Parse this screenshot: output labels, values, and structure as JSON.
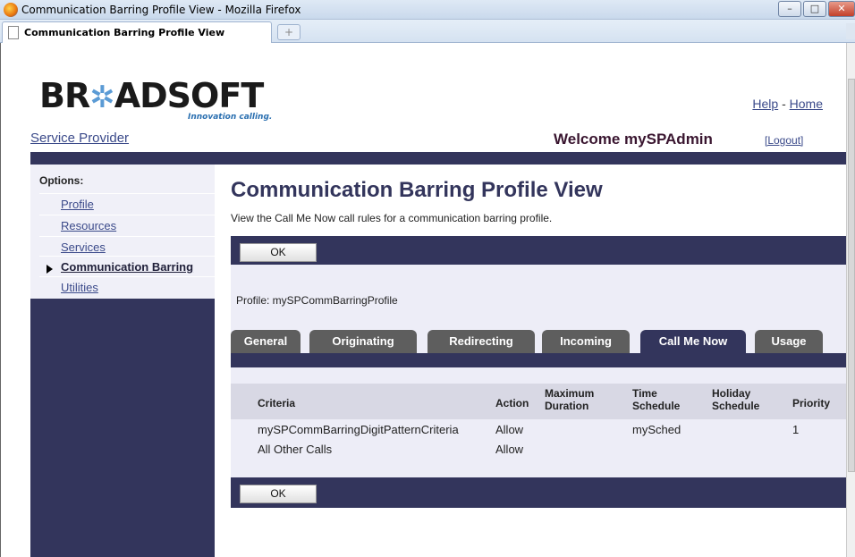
{
  "window": {
    "title": "Communication Barring Profile View - Mozilla Firefox",
    "tab_label": "Communication Barring Profile View",
    "new_tab_symbol": "+",
    "controls": {
      "minimize": "–",
      "maximize": "□",
      "close": "✕"
    }
  },
  "header": {
    "logo_text_1": "BR",
    "logo_star": "✲",
    "logo_text_2": "ADSOFT",
    "tagline": "Innovation calling.",
    "help_link": "Help",
    "separator": "-",
    "home_link": "Home",
    "service_provider_link": "Service Provider",
    "welcome": "Welcome mySPAdmin",
    "logout": "[Logout]"
  },
  "sidebar": {
    "title": "Options:",
    "items": [
      {
        "label": "Profile",
        "active": false
      },
      {
        "label": "Resources",
        "active": false
      },
      {
        "label": "Services",
        "active": false
      },
      {
        "label": "Communication Barring",
        "active": true
      },
      {
        "label": "Utilities",
        "active": false
      }
    ]
  },
  "main": {
    "title": "Communication Barring Profile View",
    "description": "View the Call Me Now call rules for a communication barring profile.",
    "ok_label": "OK",
    "profile_line": "Profile: mySPCommBarringProfile",
    "tabs": [
      {
        "label": "General",
        "active": false
      },
      {
        "label": "Originating",
        "active": false
      },
      {
        "label": "Redirecting",
        "active": false
      },
      {
        "label": "Incoming",
        "active": false
      },
      {
        "label": "Call Me Now",
        "active": true
      },
      {
        "label": "Usage",
        "active": false
      }
    ],
    "table": {
      "headers": {
        "criteria": "Criteria",
        "action": "Action",
        "max_duration_1": "Maximum",
        "max_duration_2": "Duration",
        "time_schedule_1": "Time",
        "time_schedule_2": "Schedule",
        "holiday_schedule_1": "Holiday",
        "holiday_schedule_2": "Schedule",
        "priority": "Priority"
      },
      "rows": [
        {
          "criteria": "mySPCommBarringDigitPatternCriteria",
          "action": "Allow",
          "max_duration": "",
          "time_schedule": "mySched",
          "holiday_schedule": "",
          "priority": "1"
        },
        {
          "criteria": "All Other Calls",
          "action": "Allow",
          "max_duration": "",
          "time_schedule": "",
          "holiday_schedule": "",
          "priority": ""
        }
      ]
    }
  },
  "colors": {
    "nav_dark": "#33355c",
    "panel_light": "#ededf7",
    "tab_inactive": "#5e5e5e",
    "link": "#3b4a8a"
  }
}
